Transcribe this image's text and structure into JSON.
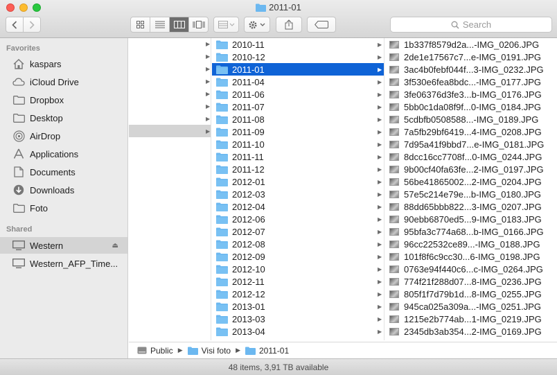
{
  "window": {
    "title": "2011-01"
  },
  "toolbar": {
    "back_icon": "chevron-left-icon",
    "forward_icon": "chevron-right-icon",
    "view_modes": [
      "icon-view",
      "list-view",
      "column-view",
      "cover-flow-view"
    ],
    "active_view": "column-view",
    "search_placeholder": "Search"
  },
  "sidebar": {
    "favorites_label": "Favorites",
    "favorites": [
      {
        "label": "kaspars",
        "icon": "home-icon"
      },
      {
        "label": "iCloud Drive",
        "icon": "cloud-icon"
      },
      {
        "label": "Dropbox",
        "icon": "folder-icon"
      },
      {
        "label": "Desktop",
        "icon": "folder-icon"
      },
      {
        "label": "AirDrop",
        "icon": "airdrop-icon"
      },
      {
        "label": "Applications",
        "icon": "applications-icon"
      },
      {
        "label": "Documents",
        "icon": "document-icon"
      },
      {
        "label": "Downloads",
        "icon": "download-icon"
      },
      {
        "label": "Foto",
        "icon": "folder-icon"
      }
    ],
    "shared_label": "Shared",
    "shared": [
      {
        "label": "Western",
        "icon": "display-icon",
        "selected": true
      },
      {
        "label": "Western_AFP_Time...",
        "icon": "display-icon",
        "selected": false
      }
    ]
  },
  "folders": [
    "2010-11",
    "2010-12",
    "2011-01",
    "2011-04",
    "2011-06",
    "2011-07",
    "2011-08",
    "2011-09",
    "2011-10",
    "2011-11",
    "2011-12",
    "2012-01",
    "2012-03",
    "2012-04",
    "2012-06",
    "2012-07",
    "2012-08",
    "2012-09",
    "2012-10",
    "2012-11",
    "2012-12",
    "2013-01",
    "2013-03",
    "2013-04"
  ],
  "selected_folder": "2011-01",
  "files": [
    "1b337f8579d2a...-IMG_0206.JPG",
    "2de1e17567c7...e-IMG_0191.JPG",
    "3ac4b0febf044f...3-IMG_0232.JPG",
    "3f530e6fea8bdc...-IMG_0177.JPG",
    "3fe06376d3fe3...b-IMG_0176.JPG",
    "5bb0c1da08f9f...0-IMG_0184.JPG",
    "5cdbfb0508588...-IMG_0189.JPG",
    "7a5fb29bf6419...4-IMG_0208.JPG",
    "7d95a41f9bbd7...e-IMG_0181.JPG",
    "8dcc16cc7708f...0-IMG_0244.JPG",
    "9b00cf40fa63fe...2-IMG_0197.JPG",
    "56be41865002...2-IMG_0204.JPG",
    "57e5c214e79e...b-IMG_0180.JPG",
    "88dd65bbb822...3-IMG_0207.JPG",
    "90ebb6870ed5...9-IMG_0183.JPG",
    "95bfa3c774a68...b-IMG_0166.JPG",
    "96cc22532ce89...-IMG_0188.JPG",
    "101f8f6c9cc30...6-IMG_0198.JPG",
    "0763e94f440c6...c-IMG_0264.JPG",
    "774f21f288d07...8-IMG_0236.JPG",
    "805f1f7d79b1d...8-IMG_0255.JPG",
    "945ca025a309a...-IMG_0251.JPG",
    "1215e2b774ab...1-IMG_0219.JPG",
    "2345db3ab354...2-IMG_0169.JPG"
  ],
  "pathbar": [
    {
      "label": "Public",
      "icon": "drive-icon"
    },
    {
      "label": "Visi foto",
      "icon": "folder-icon"
    },
    {
      "label": "2011-01",
      "icon": "folder-icon"
    }
  ],
  "status": {
    "text": "48 items, 3,91 TB available"
  },
  "colors": {
    "selection": "#0f63d6",
    "folder": "#6cb8f0",
    "sidebar_bg": "#ebebeb"
  }
}
